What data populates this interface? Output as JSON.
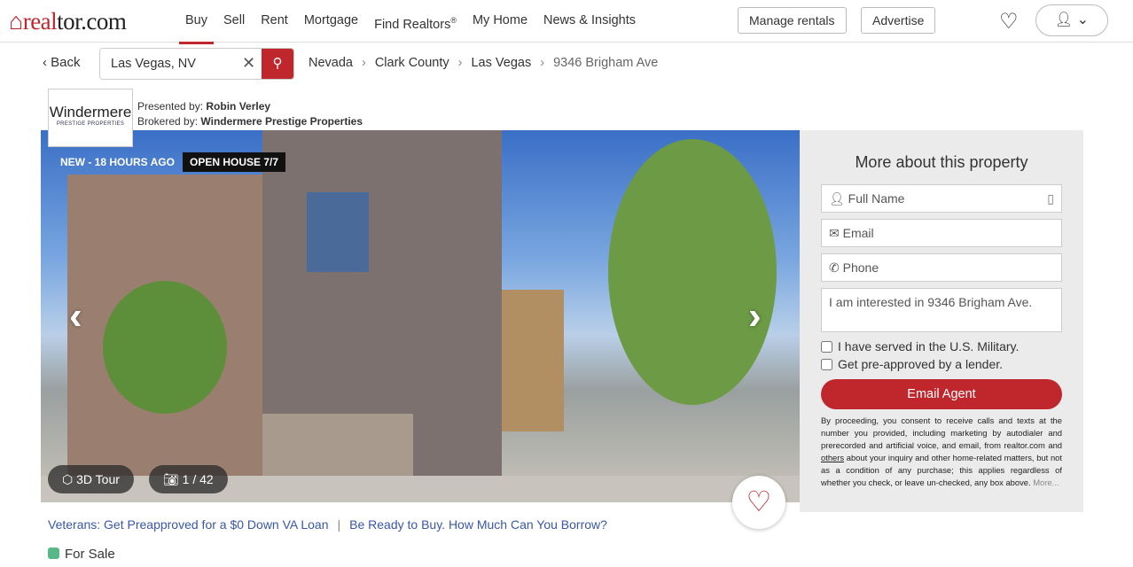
{
  "header": {
    "logo": "realtor.com",
    "nav": [
      "Buy",
      "Sell",
      "Rent",
      "Mortgage",
      "Find Realtors",
      "My Home",
      "News & Insights"
    ],
    "find_realtors_mark": "®",
    "manage_rentals": "Manage rentals",
    "advertise": "Advertise"
  },
  "subbar": {
    "back": "Back",
    "search_value": "Las Vegas, NV",
    "breadcrumbs": [
      "Nevada",
      "Clark County",
      "Las Vegas",
      "9346 Brigham Ave"
    ]
  },
  "broker": {
    "logo_name": "Windermere",
    "logo_sub": "PRESTIGE PROPERTIES",
    "presented_label": "Presented by:",
    "presented_name": "Robin Verley",
    "brokered_label": "Brokered by:",
    "brokered_name": "Windermere Prestige Properties"
  },
  "photo": {
    "badge_new": "NEW - 18 HOURS AGO",
    "badge_open": "OPEN HOUSE 7/7",
    "tour": "3D Tour",
    "count": "1 / 42"
  },
  "form": {
    "title": "More about this property",
    "full_name": "Full Name",
    "email": "Email",
    "phone": "Phone",
    "message": "I am interested in 9346 Brigham Ave.",
    "military": "I have served in the U.S. Military.",
    "preapproved": "Get pre-approved by a lender.",
    "submit": "Email Agent",
    "legal_1": "By proceeding, you consent to receive calls and texts at the number you provided, including marketing by autodialer and prerecorded and artificial voice, and email, from realtor.com and ",
    "legal_link": "others",
    "legal_2": " about your inquiry and other home-related matters, but not as a condition of any purchase; this applies regardless of whether you check, or leave un-checked, any box above. ",
    "legal_more": "More..."
  },
  "links": {
    "va": "Veterans: Get Preapproved for a $0 Down VA Loan",
    "borrow": "Be Ready to Buy. How Much Can You Borrow?"
  },
  "status": {
    "label": "For Sale",
    "color": "#59b88a"
  },
  "colors": {
    "brand": "#c0272d",
    "link": "#3a57a8"
  }
}
